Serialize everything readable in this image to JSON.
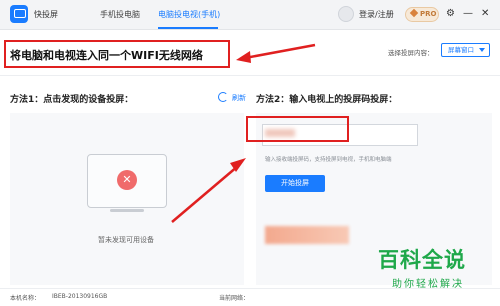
{
  "app": {
    "name": "快投屏"
  },
  "tabs": [
    {
      "label": "手机投电脑"
    },
    {
      "label": "电脑投电视(手机)"
    }
  ],
  "header": {
    "login_label": "登录/注册",
    "pro_label": "PRO"
  },
  "annotation": {
    "headline": "将电脑和电视连入同一个WIFI无线网络"
  },
  "projection_select": {
    "label": "选择投屏内容：",
    "value": "屏幕窗口"
  },
  "method1": {
    "title": "方法1：点击发现的设备投屏：",
    "refresh_label": "刷新",
    "empty_text": "暂未发现可用设备"
  },
  "method2": {
    "title": "方法2：输入电视上的投屏码投屏：",
    "hint": "输入接收端投屏码，支持投屏到电视，手机和电脑端",
    "button_label": "开始投屏"
  },
  "footer": {
    "device_label": "本机名称：",
    "device_value": "IBEB-20130916GB",
    "network_label": "当前网络："
  },
  "watermark": {
    "main": "百科全说",
    "sub": "助你轻松解决"
  },
  "colors": {
    "accent": "#1a7cff",
    "annotation_red": "#e02020",
    "watermark_green": "#1fa84a"
  }
}
